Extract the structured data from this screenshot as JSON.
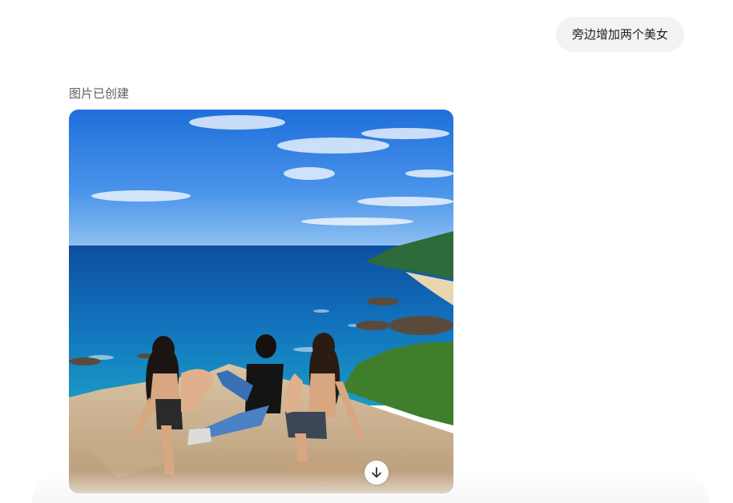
{
  "conversation": {
    "user_message": "旁边增加两个美女",
    "assistant_caption": "图片已创建"
  },
  "generated_image": {
    "scene": "ocean-cliff-with-three-people"
  },
  "icons": {
    "download": "arrow-down-icon"
  },
  "colors": {
    "bubble_bg": "#f3f3f3",
    "caption_text": "#5d5d5d",
    "sky": "#2f7fe0",
    "sea": "#1168b3"
  }
}
